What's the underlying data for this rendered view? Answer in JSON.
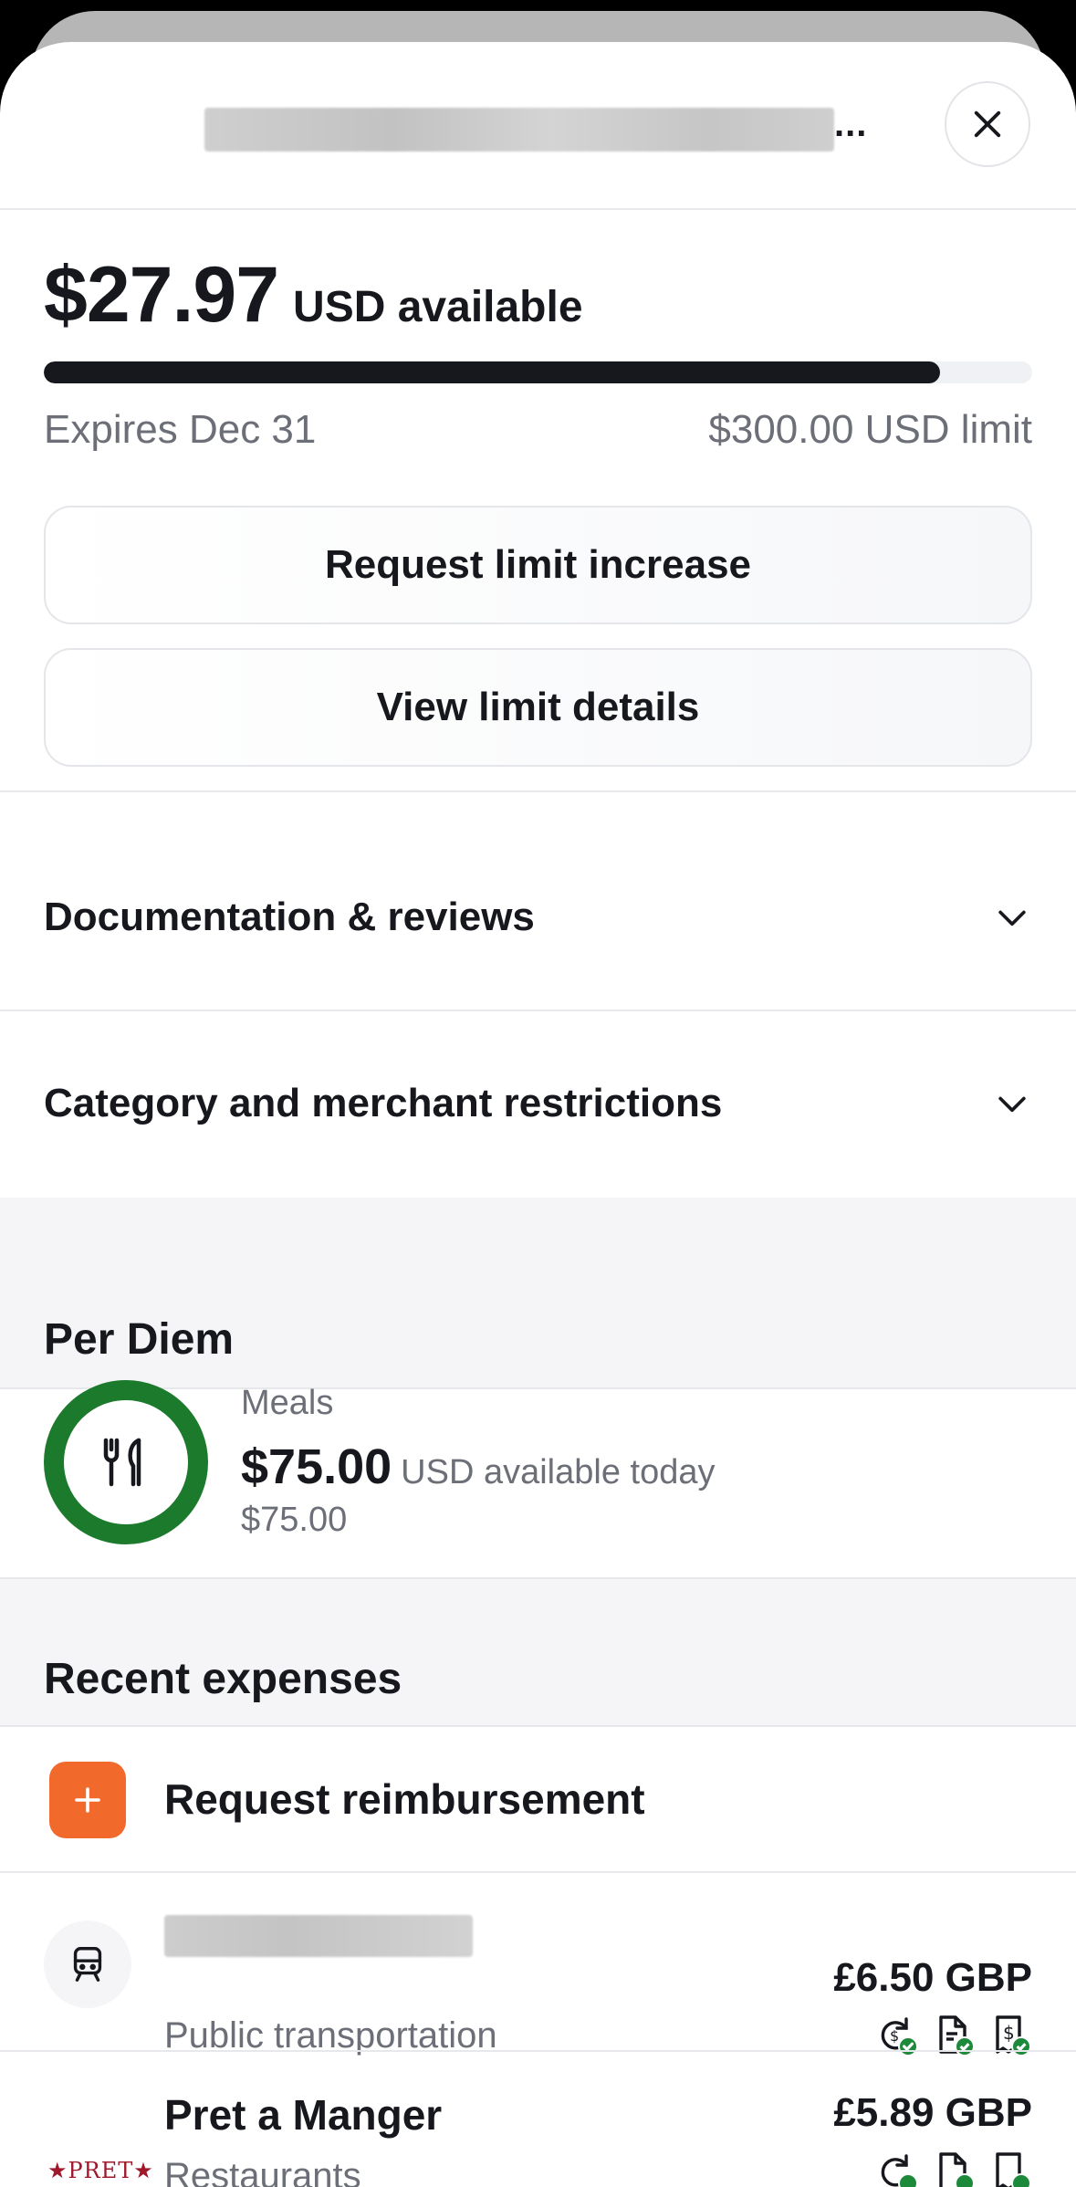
{
  "header": {
    "title_ellipsis": "...",
    "close_icon": "close-icon"
  },
  "balance": {
    "amount": "$27.97",
    "unit_label": "USD available",
    "progress_fraction": 0.907,
    "expires": "Expires Dec 31",
    "limit": "$300.00 USD limit"
  },
  "actions": {
    "request_limit_increase": "Request limit increase",
    "view_limit_details": "View limit details"
  },
  "accordions": [
    {
      "label": "Documentation & reviews",
      "icon": "chevron-down-icon"
    },
    {
      "label": "Category and merchant restrictions",
      "icon": "chevron-down-icon"
    }
  ],
  "per_diem": {
    "section_title": "Per Diem",
    "category": "Meals",
    "amount": "$75.00",
    "amount_suffix": "USD available today",
    "total": "$75.00",
    "ring_color": "#1c7a2c",
    "icon": "utensils-icon"
  },
  "recent_expenses": {
    "section_title": "Recent expenses",
    "reimbursement_label": "Request reimbursement",
    "reimbursement_color": "#f26a2b",
    "items": [
      {
        "merchant": "",
        "category": "Public transportation",
        "amount": "£6.50 GBP",
        "icon": "train-icon"
      },
      {
        "merchant": "Pret a Manger",
        "category": "Restaurants",
        "amount": "£5.89 GBP",
        "logo_text": "★PRET★"
      }
    ],
    "status_icons": [
      "receipt-refresh-check-icon",
      "document-check-icon",
      "receipt-dollar-check-icon"
    ],
    "status_color": "#1c8a3a"
  }
}
